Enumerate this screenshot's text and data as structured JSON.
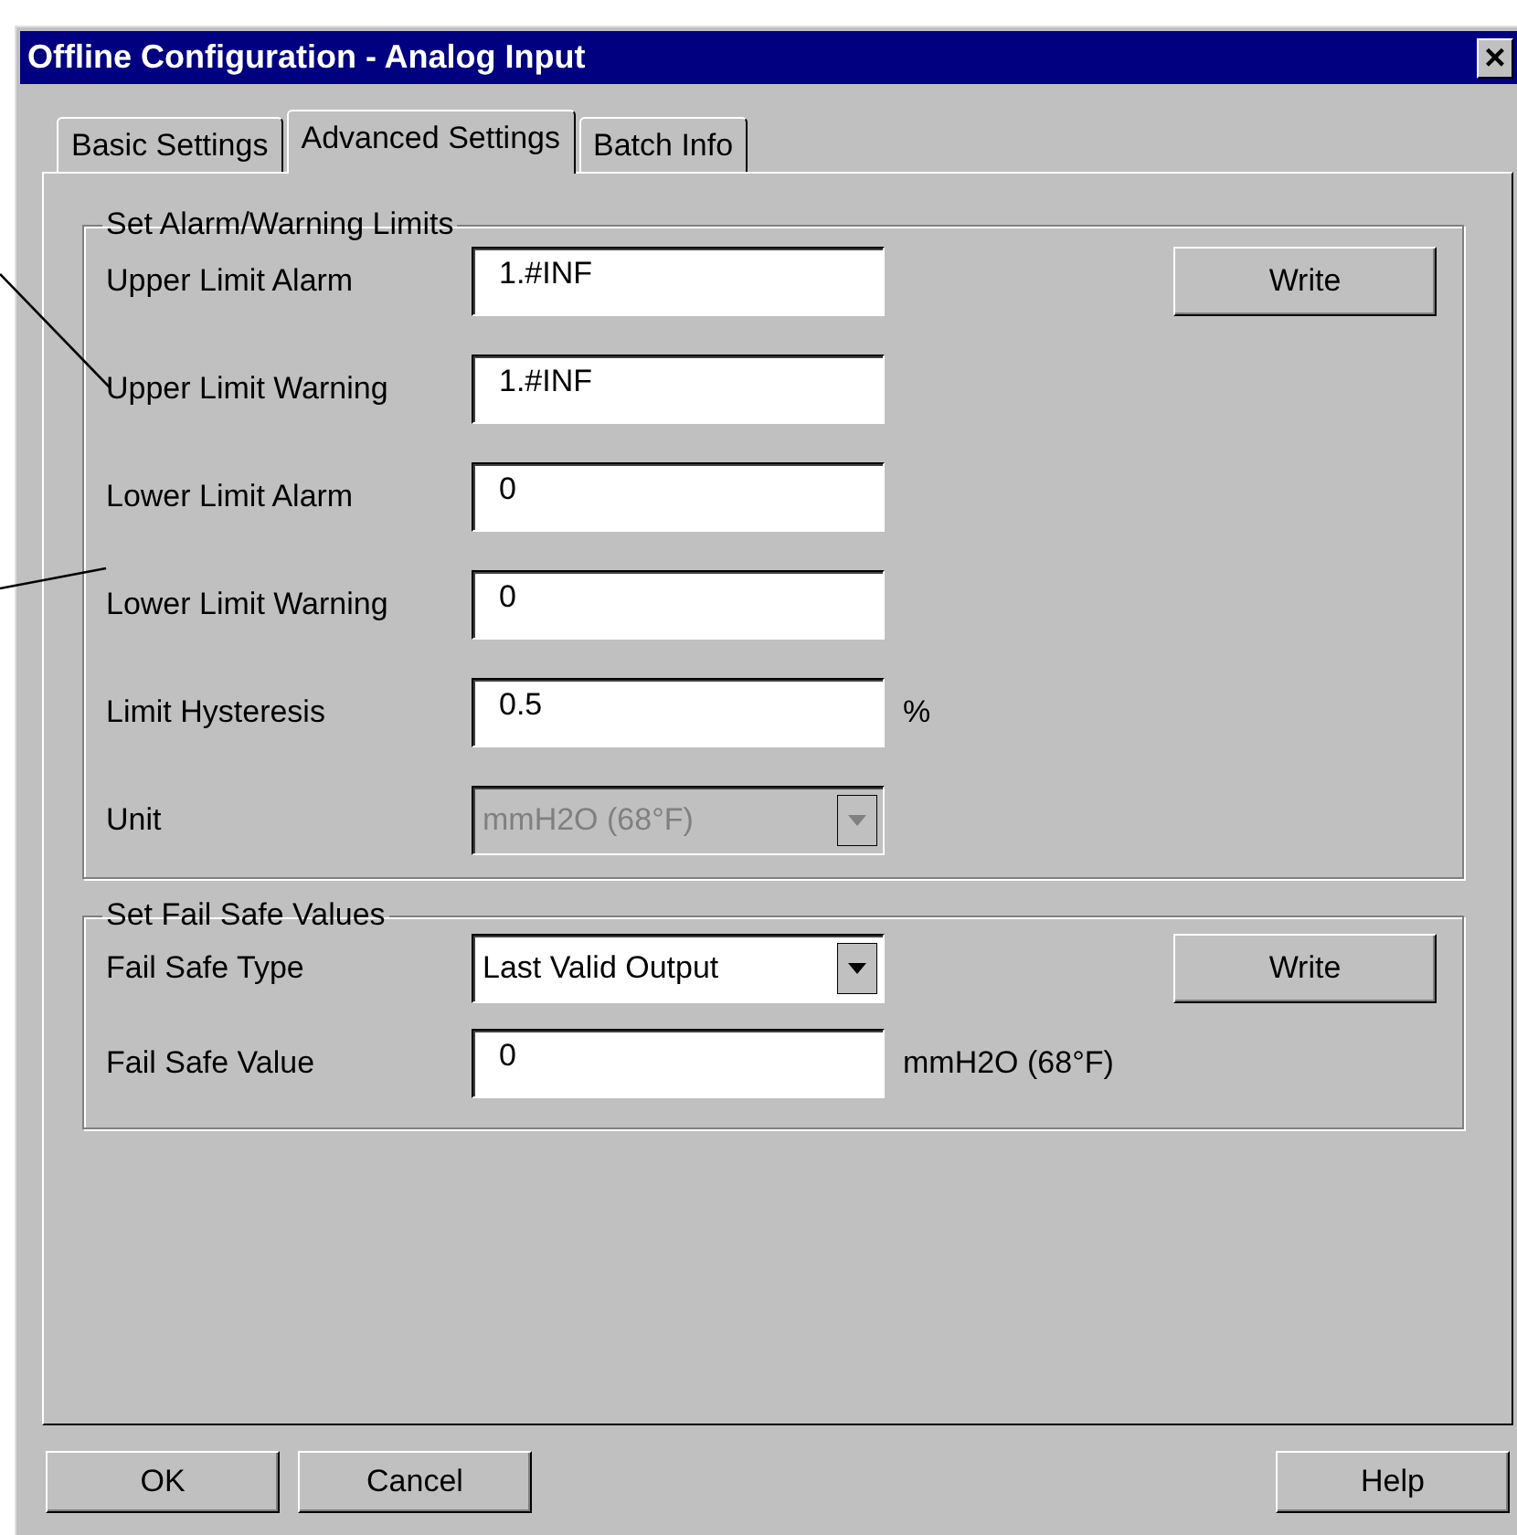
{
  "window": {
    "title": "Offline Configuration - Analog Input",
    "close": "×"
  },
  "tabs": [
    {
      "label": "Basic Settings",
      "selected": false
    },
    {
      "label": "Advanced Settings",
      "selected": true
    },
    {
      "label": "Batch Info",
      "selected": false
    }
  ],
  "groups": [
    {
      "title": "Set Alarm/Warning Limits",
      "button": "Write",
      "rows": [
        {
          "kind": "text",
          "label": "Upper Limit Alarm",
          "value": "1.#INF"
        },
        {
          "kind": "text",
          "label": "Upper Limit Warning",
          "value": "1.#INF"
        },
        {
          "kind": "text",
          "label": "Lower Limit Alarm",
          "value": "0"
        },
        {
          "kind": "text",
          "label": "Lower Limit Warning",
          "value": "0"
        },
        {
          "kind": "text",
          "label": "Limit Hysteresis",
          "value": "0.5",
          "suffix": "%"
        },
        {
          "kind": "select",
          "label": "Unit",
          "value": "mmH2O (68°F)",
          "disabled": true
        }
      ]
    },
    {
      "title": "Set Fail Safe Values",
      "button": "Write",
      "rows": [
        {
          "kind": "select",
          "label": "Fail Safe Type",
          "value": "Last Valid Output",
          "disabled": false
        },
        {
          "kind": "text",
          "label": "Fail Safe Value",
          "value": "0",
          "suffix": "mmH2O (68°F)"
        }
      ]
    }
  ],
  "buttons": [
    "OK",
    "Cancel"
  ],
  "help_button": "Help"
}
